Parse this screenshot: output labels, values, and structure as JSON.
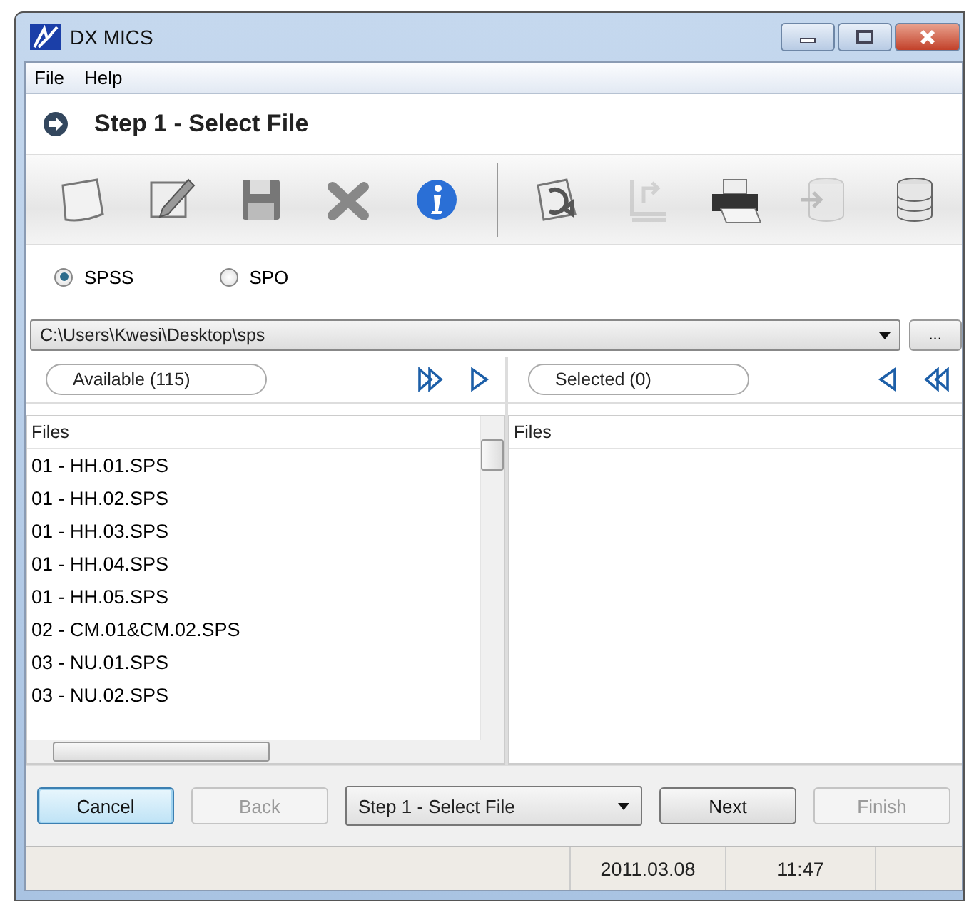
{
  "window": {
    "title": "DX MICS"
  },
  "menu": [
    "File",
    "Help"
  ],
  "step_header": "Step 1 - Select File",
  "toolbar": [
    {
      "kind": "page",
      "disabled": false
    },
    {
      "kind": "edit",
      "disabled": false
    },
    {
      "kind": "save",
      "disabled": false
    },
    {
      "kind": "delete",
      "disabled": false
    },
    {
      "kind": "info",
      "disabled": false
    },
    {
      "kind": "refresh",
      "disabled": false
    },
    {
      "kind": "import",
      "disabled": true
    },
    {
      "kind": "printer",
      "disabled": false
    },
    {
      "kind": "db-import",
      "disabled": true
    },
    {
      "kind": "database",
      "disabled": false
    }
  ],
  "format_options": [
    {
      "label": "SPSS",
      "selected": true
    },
    {
      "label": "SPO",
      "selected": false
    }
  ],
  "path": {
    "value": "C:\\Users\\Kwesi\\Desktop\\sps",
    "browse_label": "..."
  },
  "available": {
    "label": "Available (115)",
    "column": "Files",
    "items": [
      "01 - HH.01.SPS",
      "01 - HH.02.SPS",
      "01 - HH.03.SPS",
      "01 - HH.04.SPS",
      "01 - HH.05.SPS",
      "02 - CM.01&CM.02.SPS",
      "03 - NU.01.SPS",
      "03 - NU.02.SPS"
    ]
  },
  "selected": {
    "label": "Selected (0)",
    "column": "Files"
  },
  "footer": {
    "cancel": {
      "label": "Cancel",
      "disabled": false
    },
    "back": {
      "label": "Back",
      "disabled": true
    },
    "step_select": "Step 1 - Select File",
    "next": {
      "label": "Next",
      "disabled": false
    },
    "finish": {
      "label": "Finish",
      "disabled": true
    }
  },
  "status_bar": {
    "date": "2011.03.08",
    "time": "11:47"
  }
}
